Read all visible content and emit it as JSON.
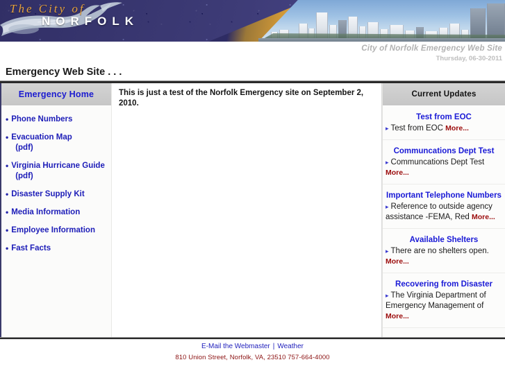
{
  "banner": {
    "logo_line1": "The  City  of",
    "logo_line2": "NORFOLK",
    "logo_icon": "mermaid-logo"
  },
  "header": {
    "site_subtitle": "City of Norfolk Emergency Web Site",
    "date": "Thursday, 06-30-2011",
    "page_title": "Emergency Web Site . . ."
  },
  "sidebar": {
    "header_label": "Emergency Home",
    "items": [
      {
        "label": "Phone Numbers",
        "sub": ""
      },
      {
        "label": "Evacuation Map",
        "sub": "(pdf)"
      },
      {
        "label": "Virginia Hurricane Guide",
        "sub": "(pdf)"
      },
      {
        "label": "Disaster Supply Kit",
        "sub": ""
      },
      {
        "label": "Media Information",
        "sub": ""
      },
      {
        "label": "Employee Information",
        "sub": ""
      },
      {
        "label": "Fast Facts",
        "sub": ""
      }
    ]
  },
  "main": {
    "body_text": "This is just a test of the Norfolk Emergency site on September 2, 2010."
  },
  "updates": {
    "header_label": "Current Updates",
    "more_label": "More...",
    "items": [
      {
        "title": "Test from EOC",
        "body": "Test from EOC"
      },
      {
        "title": "Communcations Dept Test",
        "body": "Communcations Dept Test"
      },
      {
        "title": "Important Telephone Numbers",
        "body": "Reference to outside agency assistance -FEMA, Red"
      },
      {
        "title": "Available Shelters",
        "body": "There are no shelters open."
      },
      {
        "title": "Recovering from Disaster",
        "body": "The Virginia Department of Emergency Management of"
      }
    ]
  },
  "footer": {
    "webmaster_label": "E-Mail the Webmaster",
    "separator": "|",
    "weather_label": "Weather",
    "address": "810 Union Street, Norfolk, VA, 23510 757-664-4000"
  },
  "colors": {
    "banner_purple": "#3b3a72",
    "banner_gold": "#d59b35",
    "link_blue": "#1d1db8",
    "more_red": "#9b0b0b",
    "address_red": "#8b1111",
    "subtitle_gray": "#b2b2b2",
    "panel_gray": "#cccccc"
  }
}
